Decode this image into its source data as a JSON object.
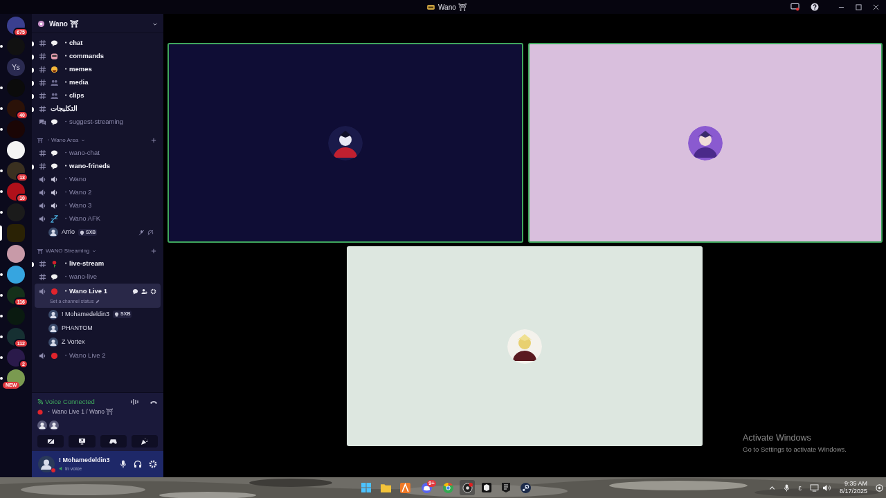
{
  "window": {
    "title": "Wano ⛩"
  },
  "servers": [
    {
      "color": "#3a3f8f",
      "badge": "675",
      "unread": false,
      "selected": false
    },
    {
      "color": "#111111",
      "unread": true,
      "selected": false
    },
    {
      "color": "#2a2a50",
      "label": "Ys",
      "unread": false,
      "selected": false
    },
    {
      "color": "#0b0b0b",
      "unread": true,
      "selected": false
    },
    {
      "color": "#2b1208",
      "badge": "40",
      "unread": true,
      "selected": false
    },
    {
      "color": "#1a0505",
      "unread": true,
      "selected": false
    },
    {
      "color": "#f4f4f4",
      "unread": false,
      "selected": false
    },
    {
      "color": "#3a3020",
      "badge": "13",
      "unread": true,
      "selected": false
    },
    {
      "color": "#b0101a",
      "badge": "10",
      "unread": true,
      "selected": false
    },
    {
      "color": "#1b1b1b",
      "unread": true,
      "selected": false
    },
    {
      "color": "#2a2205",
      "unread": false,
      "selected": true
    },
    {
      "color": "#c89aa8",
      "unread": false,
      "selected": false
    },
    {
      "color": "#36a5e0",
      "unread": true,
      "selected": false
    },
    {
      "color": "#14301a",
      "badge": "116",
      "unread": true,
      "selected": false
    },
    {
      "color": "#0a1a10",
      "unread": true,
      "selected": false
    },
    {
      "color": "#163032",
      "badge": "112",
      "unread": true,
      "selected": false
    },
    {
      "color": "#2a1a4a",
      "badge": "2",
      "unread": true,
      "selected": false
    },
    {
      "color": "#7a9a50",
      "tag": "NEW",
      "unread": true,
      "selected": false
    }
  ],
  "server_header": {
    "name": "Wano ⛩"
  },
  "sections": [
    {
      "channels": [
        {
          "kind": "text",
          "name": "・chat",
          "unread": true,
          "selected": false
        },
        {
          "kind": "text",
          "name": "・commands",
          "unread": true,
          "selected": false
        },
        {
          "kind": "text",
          "name": "・memes",
          "unread": true,
          "selected": false
        },
        {
          "kind": "text",
          "name": "・media",
          "unread": true,
          "selected": false
        },
        {
          "kind": "text",
          "name": "・clips",
          "unread": true,
          "selected": false
        },
        {
          "kind": "text",
          "name": "التكليجات",
          "unread": true,
          "selected": false
        },
        {
          "kind": "forum",
          "name": "・suggest-streaming",
          "unread": false,
          "selected": false
        }
      ]
    },
    {
      "category": "・Wano Area",
      "channels": [
        {
          "kind": "text",
          "name": "・wano-chat",
          "unread": false,
          "selected": false
        },
        {
          "kind": "text",
          "name": "・wano-frineds",
          "unread": true,
          "selected": false
        },
        {
          "kind": "voice",
          "name": "・Wano",
          "unread": false,
          "selected": false
        },
        {
          "kind": "voice",
          "name": "・Wano 2",
          "unread": false,
          "selected": false
        },
        {
          "kind": "voice",
          "name": "・Wano 3",
          "unread": false,
          "selected": false
        },
        {
          "kind": "voice",
          "name": "・Wano AFK",
          "unread": false,
          "selected": false,
          "users": [
            {
              "name": "Arrio",
              "tag": "SXB",
              "muted": true
            }
          ]
        }
      ]
    },
    {
      "category": "WANO Streaming",
      "channels": [
        {
          "kind": "text",
          "name": "・live-stream",
          "unread": true,
          "selected": false
        },
        {
          "kind": "text",
          "name": "・wano-live",
          "unread": false,
          "selected": false
        },
        {
          "kind": "voice",
          "name": "・Wano Live 1",
          "unread": false,
          "selected": true,
          "status": "Set a channel status",
          "users": [
            {
              "name": "! Mohamedeldin3",
              "tag": "SXB",
              "muted": false
            },
            {
              "name": "PHANTOM",
              "muted": false
            },
            {
              "name": "Z Vortex",
              "muted": false
            }
          ]
        },
        {
          "kind": "voice",
          "name": "・Wano Live 2",
          "unread": false,
          "selected": false
        }
      ]
    }
  ],
  "voice_panel": {
    "status": "Voice Connected",
    "channel": "・Wano Live 1 / Wano ⛩"
  },
  "user_panel": {
    "name": "! Mohamedeldin3",
    "status": "In voice"
  },
  "tiles": [
    {
      "color": "#0f0d35",
      "speaking": true
    },
    {
      "color": "#d9bfdd",
      "speaking": true
    },
    {
      "color": "#dde7e0",
      "speaking": false
    }
  ],
  "activation_notice": {
    "title": "Activate Windows",
    "subtitle": "Go to Settings to activate Windows."
  },
  "taskbar": {
    "discord_badge": "9+",
    "input_indicator": "ε",
    "time": "9:35 AM",
    "date": "8/17/2025"
  }
}
